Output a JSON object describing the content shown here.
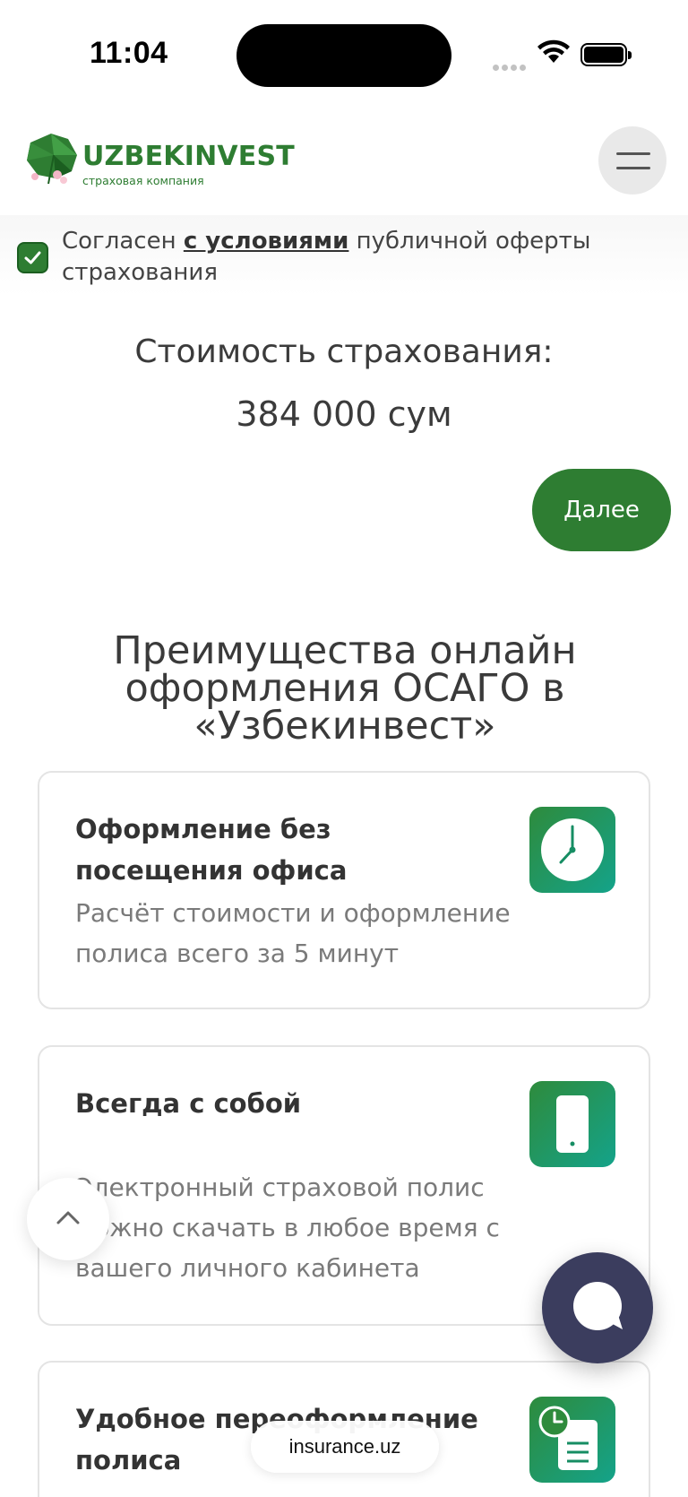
{
  "status_bar": {
    "time": "11:04"
  },
  "header": {
    "logo_name": "UZBEKINVEST",
    "logo_sub": "страховая компания"
  },
  "agree": {
    "prefix": "Согласен ",
    "link": "с условиями",
    "suffix": " публичной оферты страхования",
    "checked": true
  },
  "price": {
    "label": "Стоимость страхования:",
    "value": "384 000 сум"
  },
  "next_label": "Далее",
  "section_title": "Преимущества онлайн оформления ОСАГО в «Узбекинвест»",
  "cards": [
    {
      "title": "Оформление без посещения офиса",
      "text": "Расчёт стоимости и оформление полиса всего за 5 минут",
      "icon": "clock-icon"
    },
    {
      "title": "Всегда с собой",
      "text": "Электронный страховой полис можно скачать в любое время с вашего личного кабинета",
      "icon": "phone-icon"
    },
    {
      "title": "Удобное переоформление полиса",
      "text": "",
      "icon": "document-clock-icon"
    }
  ],
  "browser": {
    "url": "insurance.uz"
  },
  "colors": {
    "brand_green": "#2e7d32",
    "chat": "#3b3d5e"
  }
}
